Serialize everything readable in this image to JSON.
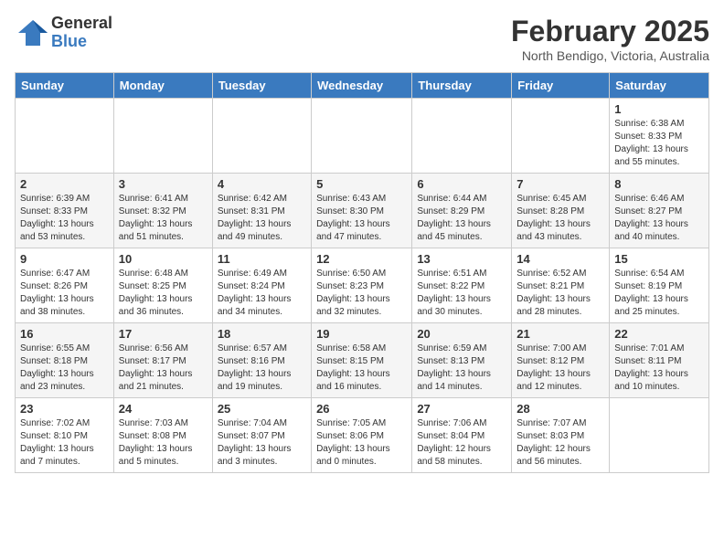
{
  "header": {
    "logo_general": "General",
    "logo_blue": "Blue",
    "month_title": "February 2025",
    "location": "North Bendigo, Victoria, Australia"
  },
  "weekdays": [
    "Sunday",
    "Monday",
    "Tuesday",
    "Wednesday",
    "Thursday",
    "Friday",
    "Saturday"
  ],
  "weeks": [
    [
      {
        "day": "",
        "info": ""
      },
      {
        "day": "",
        "info": ""
      },
      {
        "day": "",
        "info": ""
      },
      {
        "day": "",
        "info": ""
      },
      {
        "day": "",
        "info": ""
      },
      {
        "day": "",
        "info": ""
      },
      {
        "day": "1",
        "info": "Sunrise: 6:38 AM\nSunset: 8:33 PM\nDaylight: 13 hours\nand 55 minutes."
      }
    ],
    [
      {
        "day": "2",
        "info": "Sunrise: 6:39 AM\nSunset: 8:33 PM\nDaylight: 13 hours\nand 53 minutes."
      },
      {
        "day": "3",
        "info": "Sunrise: 6:41 AM\nSunset: 8:32 PM\nDaylight: 13 hours\nand 51 minutes."
      },
      {
        "day": "4",
        "info": "Sunrise: 6:42 AM\nSunset: 8:31 PM\nDaylight: 13 hours\nand 49 minutes."
      },
      {
        "day": "5",
        "info": "Sunrise: 6:43 AM\nSunset: 8:30 PM\nDaylight: 13 hours\nand 47 minutes."
      },
      {
        "day": "6",
        "info": "Sunrise: 6:44 AM\nSunset: 8:29 PM\nDaylight: 13 hours\nand 45 minutes."
      },
      {
        "day": "7",
        "info": "Sunrise: 6:45 AM\nSunset: 8:28 PM\nDaylight: 13 hours\nand 43 minutes."
      },
      {
        "day": "8",
        "info": "Sunrise: 6:46 AM\nSunset: 8:27 PM\nDaylight: 13 hours\nand 40 minutes."
      }
    ],
    [
      {
        "day": "9",
        "info": "Sunrise: 6:47 AM\nSunset: 8:26 PM\nDaylight: 13 hours\nand 38 minutes."
      },
      {
        "day": "10",
        "info": "Sunrise: 6:48 AM\nSunset: 8:25 PM\nDaylight: 13 hours\nand 36 minutes."
      },
      {
        "day": "11",
        "info": "Sunrise: 6:49 AM\nSunset: 8:24 PM\nDaylight: 13 hours\nand 34 minutes."
      },
      {
        "day": "12",
        "info": "Sunrise: 6:50 AM\nSunset: 8:23 PM\nDaylight: 13 hours\nand 32 minutes."
      },
      {
        "day": "13",
        "info": "Sunrise: 6:51 AM\nSunset: 8:22 PM\nDaylight: 13 hours\nand 30 minutes."
      },
      {
        "day": "14",
        "info": "Sunrise: 6:52 AM\nSunset: 8:21 PM\nDaylight: 13 hours\nand 28 minutes."
      },
      {
        "day": "15",
        "info": "Sunrise: 6:54 AM\nSunset: 8:19 PM\nDaylight: 13 hours\nand 25 minutes."
      }
    ],
    [
      {
        "day": "16",
        "info": "Sunrise: 6:55 AM\nSunset: 8:18 PM\nDaylight: 13 hours\nand 23 minutes."
      },
      {
        "day": "17",
        "info": "Sunrise: 6:56 AM\nSunset: 8:17 PM\nDaylight: 13 hours\nand 21 minutes."
      },
      {
        "day": "18",
        "info": "Sunrise: 6:57 AM\nSunset: 8:16 PM\nDaylight: 13 hours\nand 19 minutes."
      },
      {
        "day": "19",
        "info": "Sunrise: 6:58 AM\nSunset: 8:15 PM\nDaylight: 13 hours\nand 16 minutes."
      },
      {
        "day": "20",
        "info": "Sunrise: 6:59 AM\nSunset: 8:13 PM\nDaylight: 13 hours\nand 14 minutes."
      },
      {
        "day": "21",
        "info": "Sunrise: 7:00 AM\nSunset: 8:12 PM\nDaylight: 13 hours\nand 12 minutes."
      },
      {
        "day": "22",
        "info": "Sunrise: 7:01 AM\nSunset: 8:11 PM\nDaylight: 13 hours\nand 10 minutes."
      }
    ],
    [
      {
        "day": "23",
        "info": "Sunrise: 7:02 AM\nSunset: 8:10 PM\nDaylight: 13 hours\nand 7 minutes."
      },
      {
        "day": "24",
        "info": "Sunrise: 7:03 AM\nSunset: 8:08 PM\nDaylight: 13 hours\nand 5 minutes."
      },
      {
        "day": "25",
        "info": "Sunrise: 7:04 AM\nSunset: 8:07 PM\nDaylight: 13 hours\nand 3 minutes."
      },
      {
        "day": "26",
        "info": "Sunrise: 7:05 AM\nSunset: 8:06 PM\nDaylight: 13 hours\nand 0 minutes."
      },
      {
        "day": "27",
        "info": "Sunrise: 7:06 AM\nSunset: 8:04 PM\nDaylight: 12 hours\nand 58 minutes."
      },
      {
        "day": "28",
        "info": "Sunrise: 7:07 AM\nSunset: 8:03 PM\nDaylight: 12 hours\nand 56 minutes."
      },
      {
        "day": "",
        "info": ""
      }
    ]
  ]
}
